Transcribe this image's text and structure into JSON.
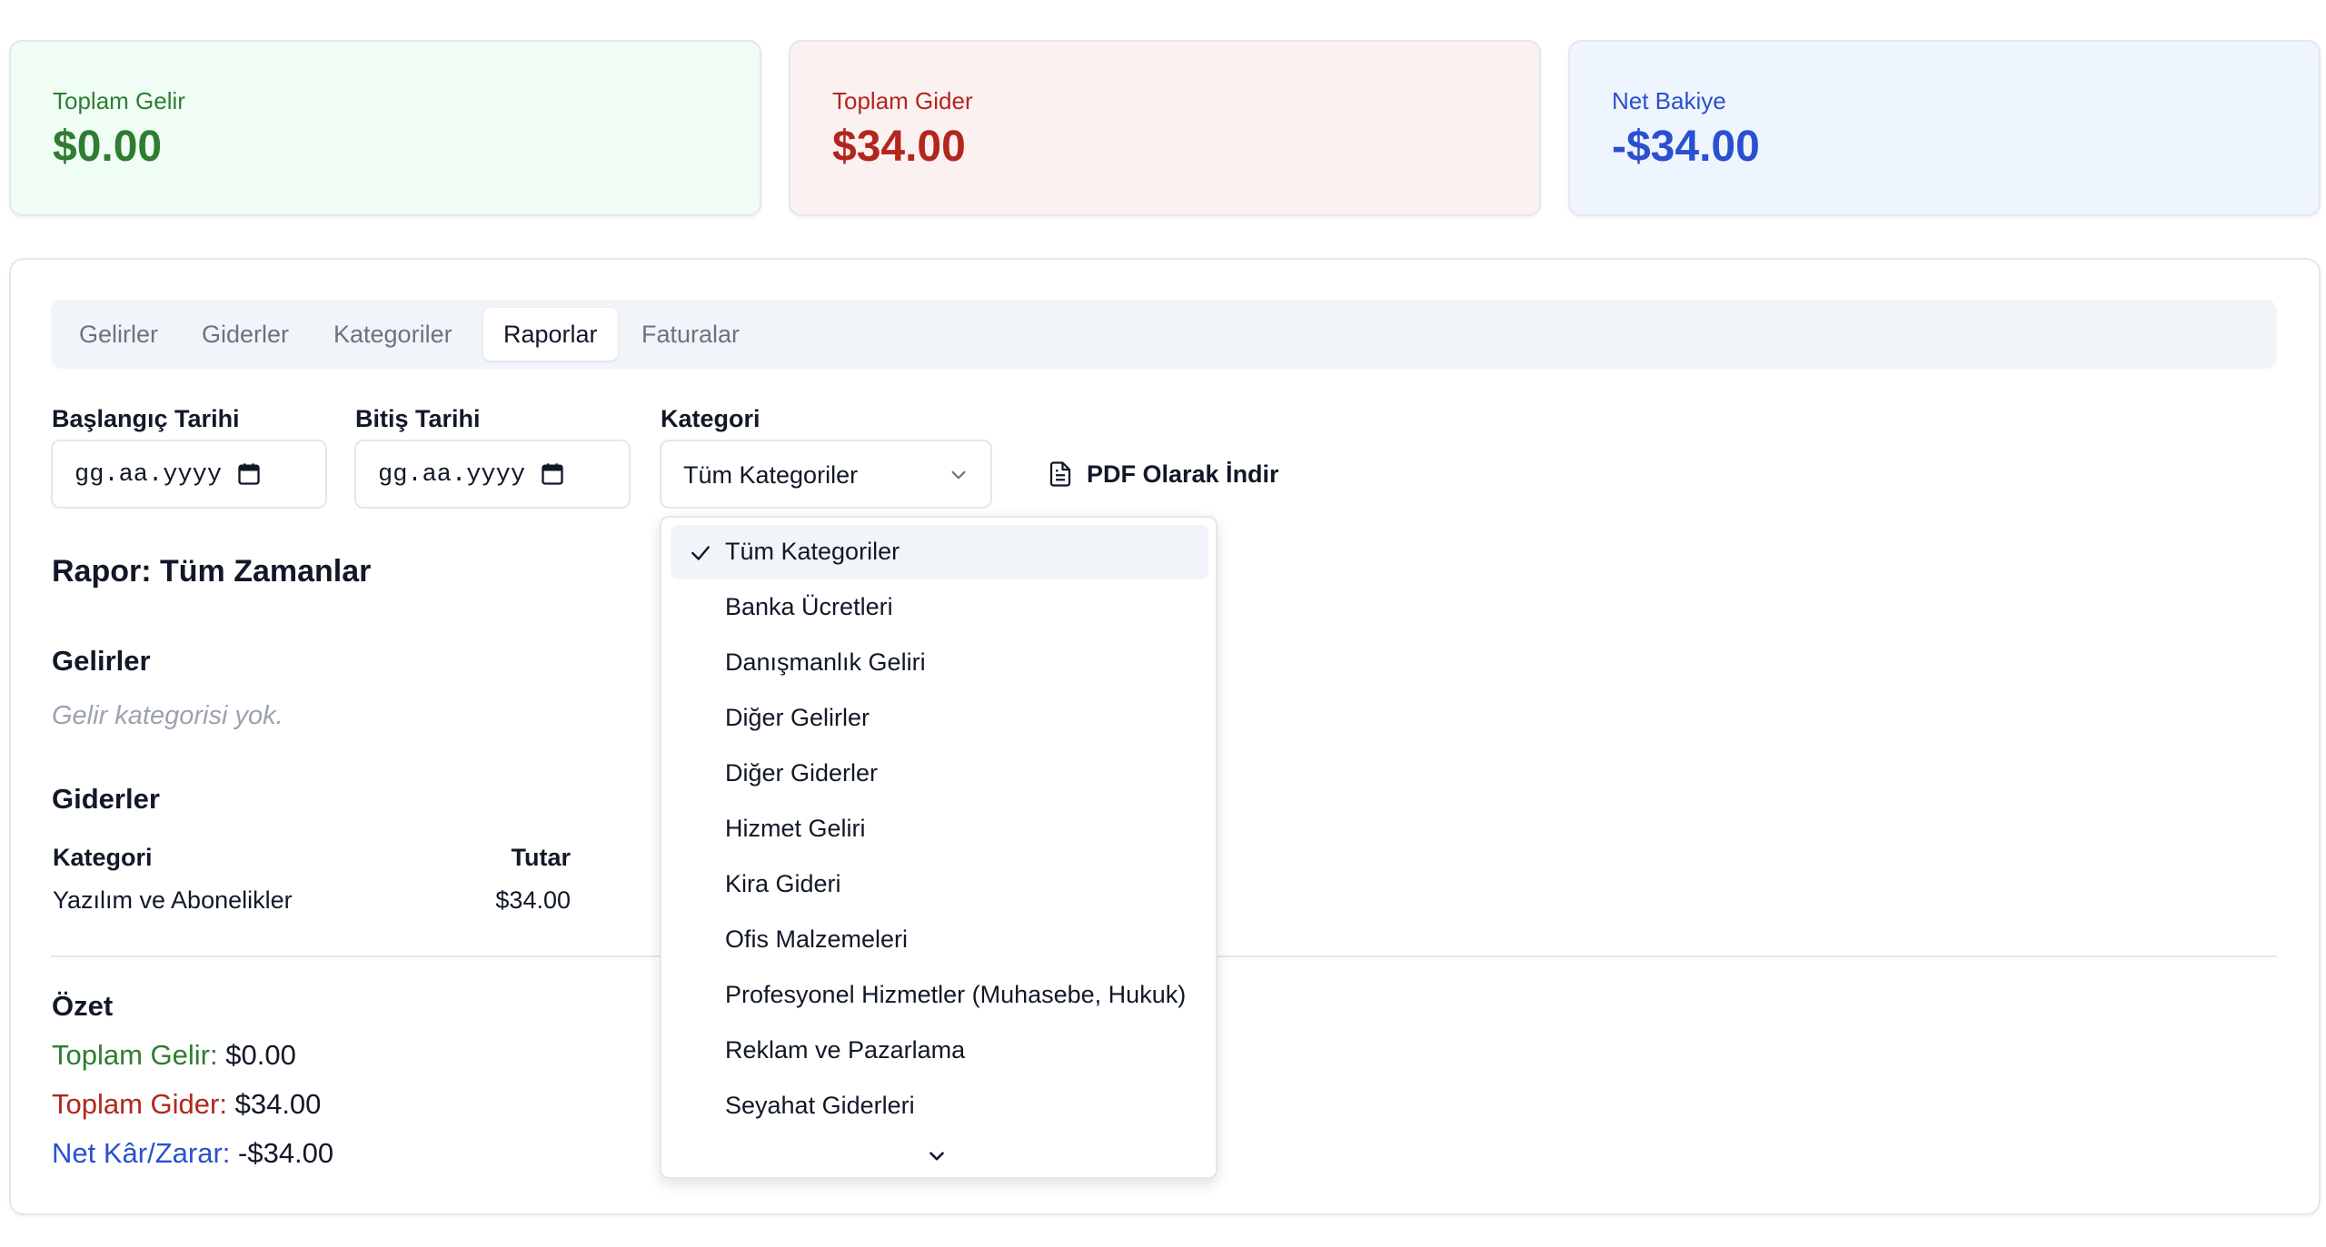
{
  "stats": {
    "income": {
      "label": "Toplam Gelir",
      "value": "$0.00"
    },
    "expense": {
      "label": "Toplam Gider",
      "value": "$34.00"
    },
    "balance": {
      "label": "Net Bakiye",
      "value": "-$34.00"
    }
  },
  "tabs": [
    {
      "label": "Gelirler"
    },
    {
      "label": "Giderler"
    },
    {
      "label": "Kategoriler"
    },
    {
      "label": "Raporlar",
      "active": true
    },
    {
      "label": "Faturalar"
    }
  ],
  "filters": {
    "start_label": "Başlangıç Tarihi",
    "start_placeholder": "gg.aa.yyyy",
    "end_label": "Bitiş Tarihi",
    "end_placeholder": "gg.aa.yyyy",
    "category_label": "Kategori",
    "category_value": "Tüm Kategoriler",
    "pdf_label": "PDF Olarak İndir"
  },
  "report": {
    "title": "Rapor: Tüm Zamanlar",
    "income_heading": "Gelirler",
    "income_empty": "Gelir kategorisi yok.",
    "expense_heading": "Giderler",
    "table": {
      "headers": [
        "Kategori",
        "Tutar"
      ],
      "rows": [
        [
          "Yazılım ve Abonelikler",
          "$34.00"
        ]
      ]
    },
    "summary": {
      "heading": "Özet",
      "income_key": "Toplam Gelir:",
      "income_val": "$0.00",
      "expense_key": "Toplam Gider:",
      "expense_val": "$34.00",
      "net_key": "Net Kâr/Zarar:",
      "net_val": "-$34.00"
    }
  },
  "dropdown": {
    "options": [
      "Tüm Kategoriler",
      "Banka Ücretleri",
      "Danışmanlık Geliri",
      "Diğer Gelirler",
      "Diğer Giderler",
      "Hizmet Geliri",
      "Kira Gideri",
      "Ofis Malzemeleri",
      "Profesyonel Hizmetler (Muhasebe, Hukuk)",
      "Reklam ve Pazarlama",
      "Seyahat Giderleri"
    ],
    "selected_index": 0
  },
  "colors": {
    "income": "#2e7d32",
    "expense": "#b3261e",
    "balance": "#2a4fd0"
  }
}
